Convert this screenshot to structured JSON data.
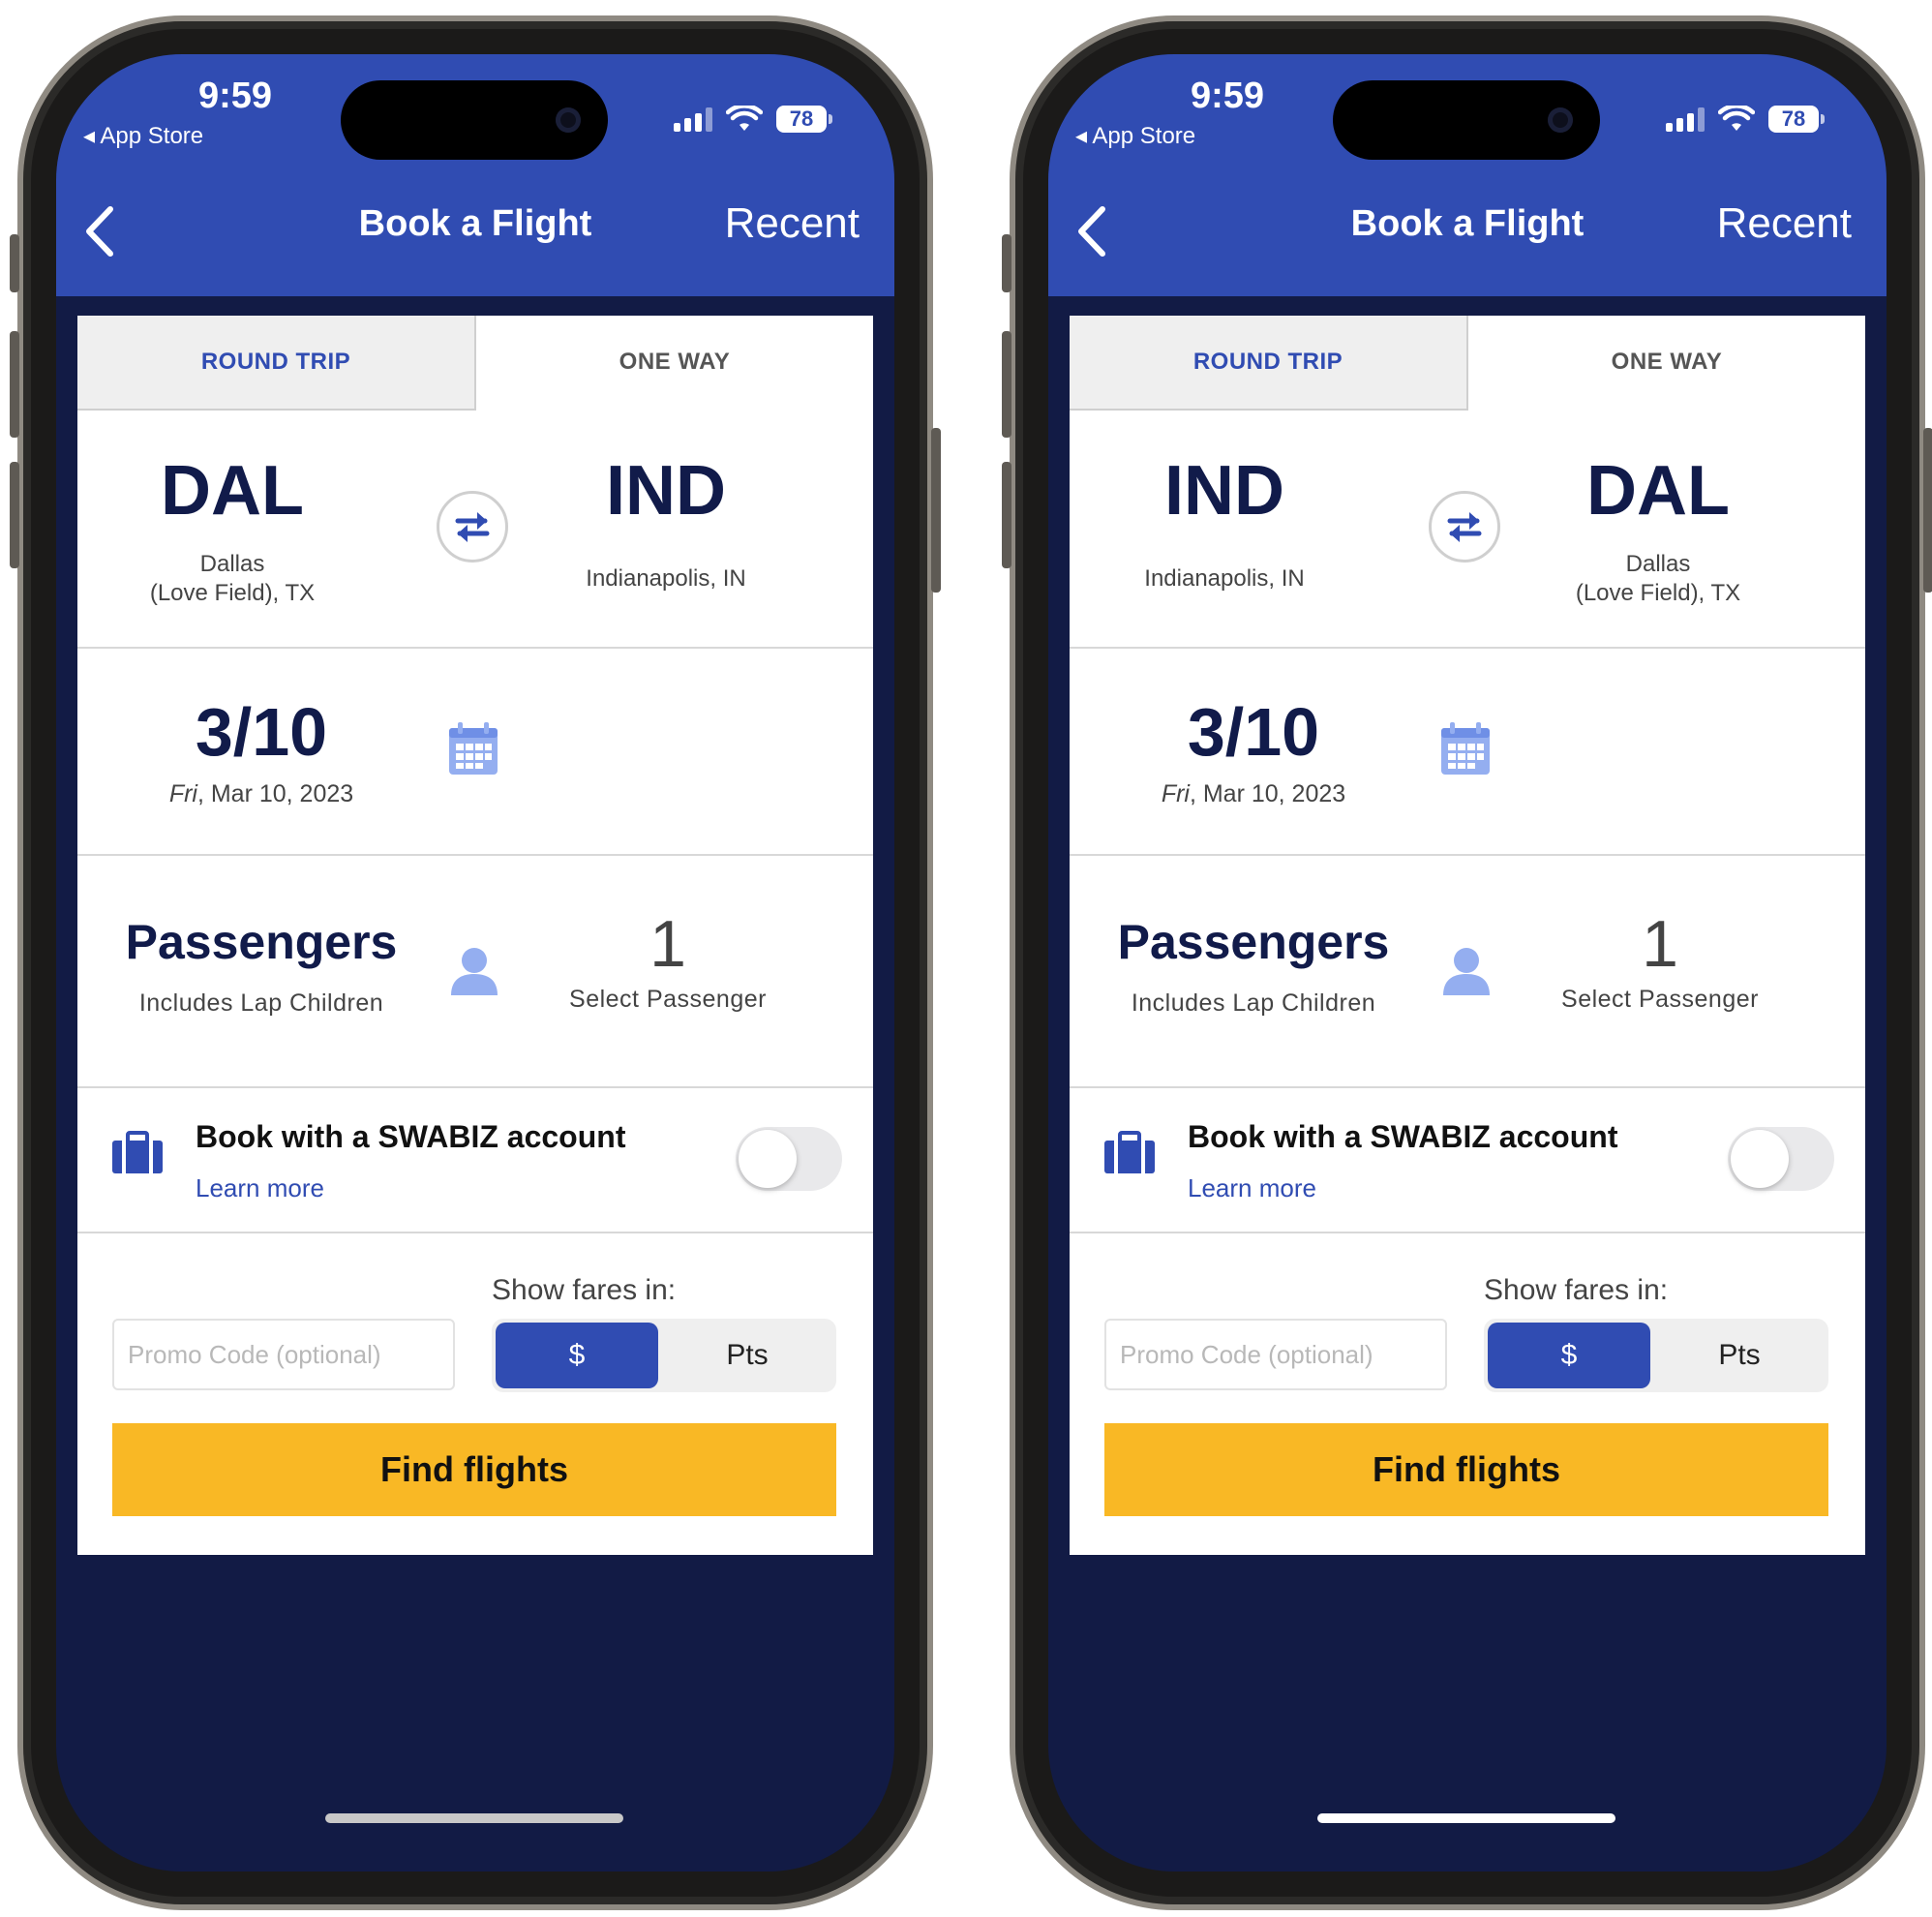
{
  "screens": [
    {
      "status": {
        "time": "9:59",
        "back_app": "◂ App Store",
        "battery": "78"
      },
      "nav": {
        "title": "Book a Flight",
        "recent": "Recent"
      },
      "tabs": {
        "round_trip": "ROUND TRIP",
        "one_way": "ONE WAY"
      },
      "origin": {
        "code": "DAL",
        "city_line1": "Dallas",
        "city_line2": "(Love Field), TX"
      },
      "destination": {
        "code": "IND",
        "city_line1": "Indianapolis, IN",
        "city_line2": ""
      },
      "date": {
        "short": "3/10",
        "full_day": "Fri",
        "full_rest": ", Mar 10, 2023"
      },
      "passengers": {
        "label": "Passengers",
        "sub": "Includes Lap Children",
        "count": "1",
        "select": "Select Passenger"
      },
      "swabiz": {
        "label": "Book with a SWABIZ account",
        "learn_more": "Learn more",
        "enabled": false
      },
      "fares": {
        "label": "Show fares in:",
        "option_dollar": "$",
        "option_pts": "Pts",
        "selected": "$"
      },
      "promo": {
        "placeholder": "Promo Code (optional)"
      },
      "find_button": "Find flights",
      "home_indicator_color": "#c8c8c8"
    },
    {
      "status": {
        "time": "9:59",
        "back_app": "◂ App Store",
        "battery": "78"
      },
      "nav": {
        "title": "Book a Flight",
        "recent": "Recent"
      },
      "tabs": {
        "round_trip": "ROUND TRIP",
        "one_way": "ONE WAY"
      },
      "origin": {
        "code": "IND",
        "city_line1": "Indianapolis, IN",
        "city_line2": ""
      },
      "destination": {
        "code": "DAL",
        "city_line1": "Dallas",
        "city_line2": "(Love Field), TX"
      },
      "date": {
        "short": "3/10",
        "full_day": "Fri",
        "full_rest": ", Mar 10, 2023"
      },
      "passengers": {
        "label": "Passengers",
        "sub": "Includes Lap Children",
        "count": "1",
        "select": "Select Passenger"
      },
      "swabiz": {
        "label": "Book with a SWABIZ account",
        "learn_more": "Learn more",
        "enabled": false
      },
      "fares": {
        "label": "Show fares in:",
        "option_dollar": "$",
        "option_pts": "Pts",
        "selected": "$"
      },
      "promo": {
        "placeholder": "Promo Code (optional)"
      },
      "find_button": "Find flights",
      "home_indicator_color": "#ffffff"
    }
  ],
  "colors": {
    "brand_blue": "#304cb2",
    "navy": "#121b45",
    "yellow": "#f9b825",
    "icon_light_blue": "#94aef0"
  }
}
